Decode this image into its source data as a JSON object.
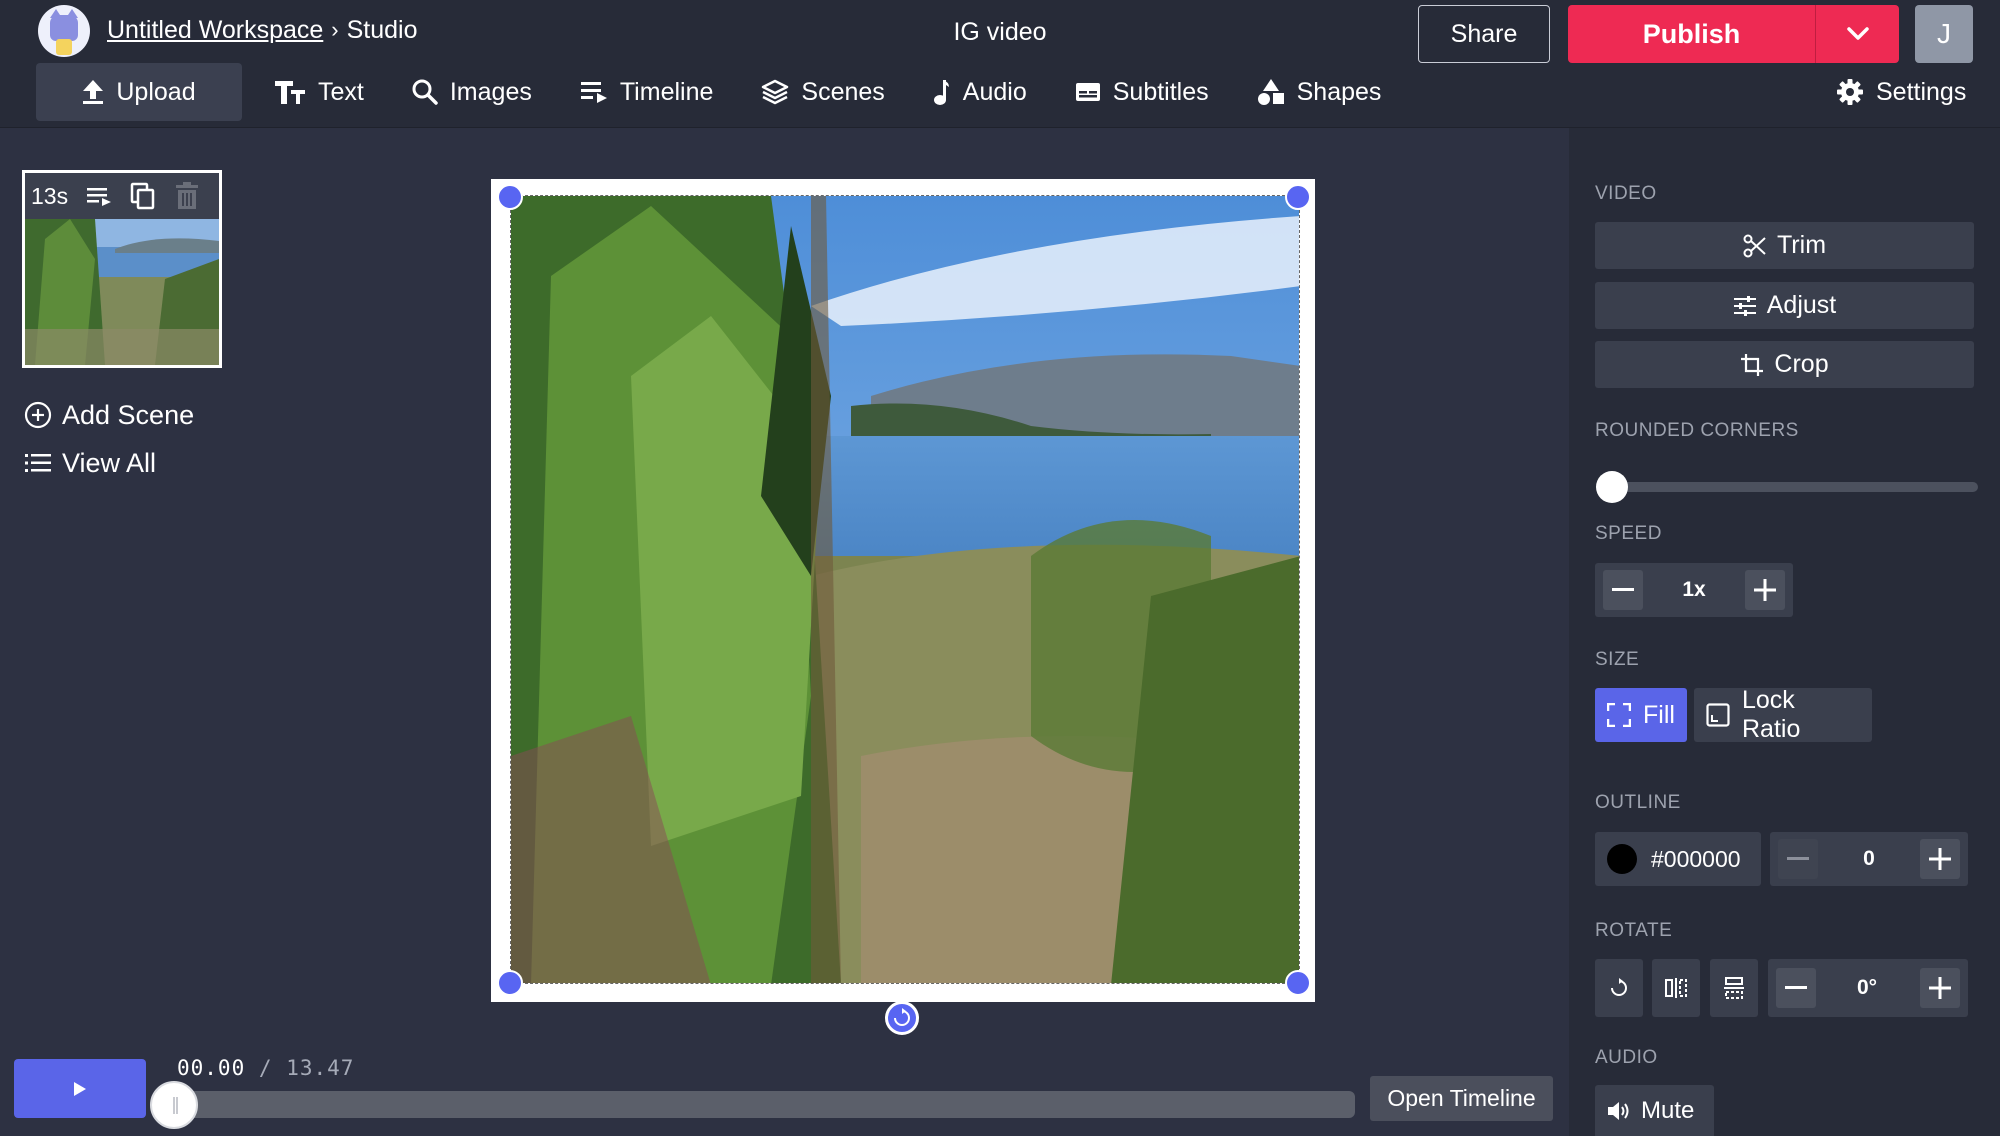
{
  "header": {
    "workspace": "Untitled Workspace",
    "separator": "›",
    "section": "Studio",
    "project_title": "IG video",
    "share_label": "Share",
    "publish_label": "Publish",
    "avatar_initial": "J"
  },
  "toolbar": {
    "items": [
      {
        "label": "Upload",
        "icon": "upload-icon"
      },
      {
        "label": "Text",
        "icon": "text-icon"
      },
      {
        "label": "Images",
        "icon": "search-icon"
      },
      {
        "label": "Timeline",
        "icon": "timeline-icon"
      },
      {
        "label": "Scenes",
        "icon": "layers-icon"
      },
      {
        "label": "Audio",
        "icon": "music-note-icon"
      },
      {
        "label": "Subtitles",
        "icon": "subtitles-icon"
      },
      {
        "label": "Shapes",
        "icon": "shapes-icon"
      }
    ],
    "settings_label": "Settings"
  },
  "scenes": {
    "scene_duration": "13s",
    "add_scene_label": "Add Scene",
    "view_all_label": "View All"
  },
  "player": {
    "current_time": "00.00",
    "divider": "/",
    "total_time": "13.47",
    "open_timeline_label": "Open Timeline",
    "progress": 0
  },
  "panel": {
    "video_label": "VIDEO",
    "trim_label": "Trim",
    "adjust_label": "Adjust",
    "crop_label": "Crop",
    "rounded_corners_label": "ROUNDED CORNERS",
    "rounded_corners_value": 0,
    "speed_label": "SPEED",
    "speed_value": "1x",
    "size_label": "SIZE",
    "fill_label": "Fill",
    "lock_ratio_label": "Lock Ratio",
    "outline_label": "OUTLINE",
    "outline_color": "#000000",
    "outline_width": "0",
    "rotate_label": "ROTATE",
    "rotate_value": "0°",
    "audio_label": "AUDIO",
    "mute_label": "Mute"
  },
  "colors": {
    "accent": "#5a65e8",
    "publish": "#ee2a53",
    "background": "#2d3142",
    "panel": "#272b38"
  }
}
